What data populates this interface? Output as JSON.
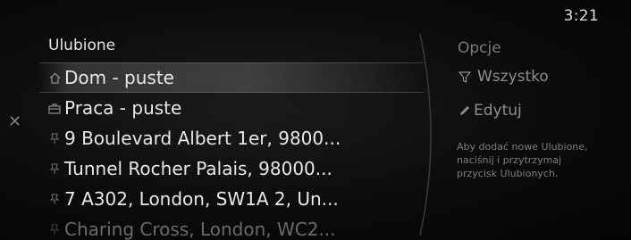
{
  "status": {
    "time": "3:21"
  },
  "favorites": {
    "title": "Ulubione",
    "items": [
      {
        "icon": "home-icon",
        "label": "Dom - puste",
        "selected": true,
        "faded": false
      },
      {
        "icon": "briefcase-icon",
        "label": "Praca - puste",
        "selected": false,
        "faded": false
      },
      {
        "icon": "pin-icon",
        "label": "9 Boulevard Albert 1er, 9800...",
        "selected": false,
        "faded": false
      },
      {
        "icon": "pin-icon",
        "label": "Tunnel Rocher Palais, 98000...",
        "selected": false,
        "faded": false
      },
      {
        "icon": "pin-icon",
        "label": "7 A302, London, SW1A 2, Un...",
        "selected": false,
        "faded": false
      },
      {
        "icon": "pin-icon",
        "label": "Charing Cross, London, WC2...",
        "selected": false,
        "faded": true
      }
    ]
  },
  "options": {
    "title": "Opcje",
    "filter_label": "Wszystko",
    "edit_label": "Edytuj",
    "hint": "Aby dodać nowe Ulubione, naciśnij i przytrzymaj przycisk Ulubionych."
  },
  "colors": {
    "text": "#e8e8e8",
    "muted": "#8e8e8e",
    "background": "#060606"
  }
}
